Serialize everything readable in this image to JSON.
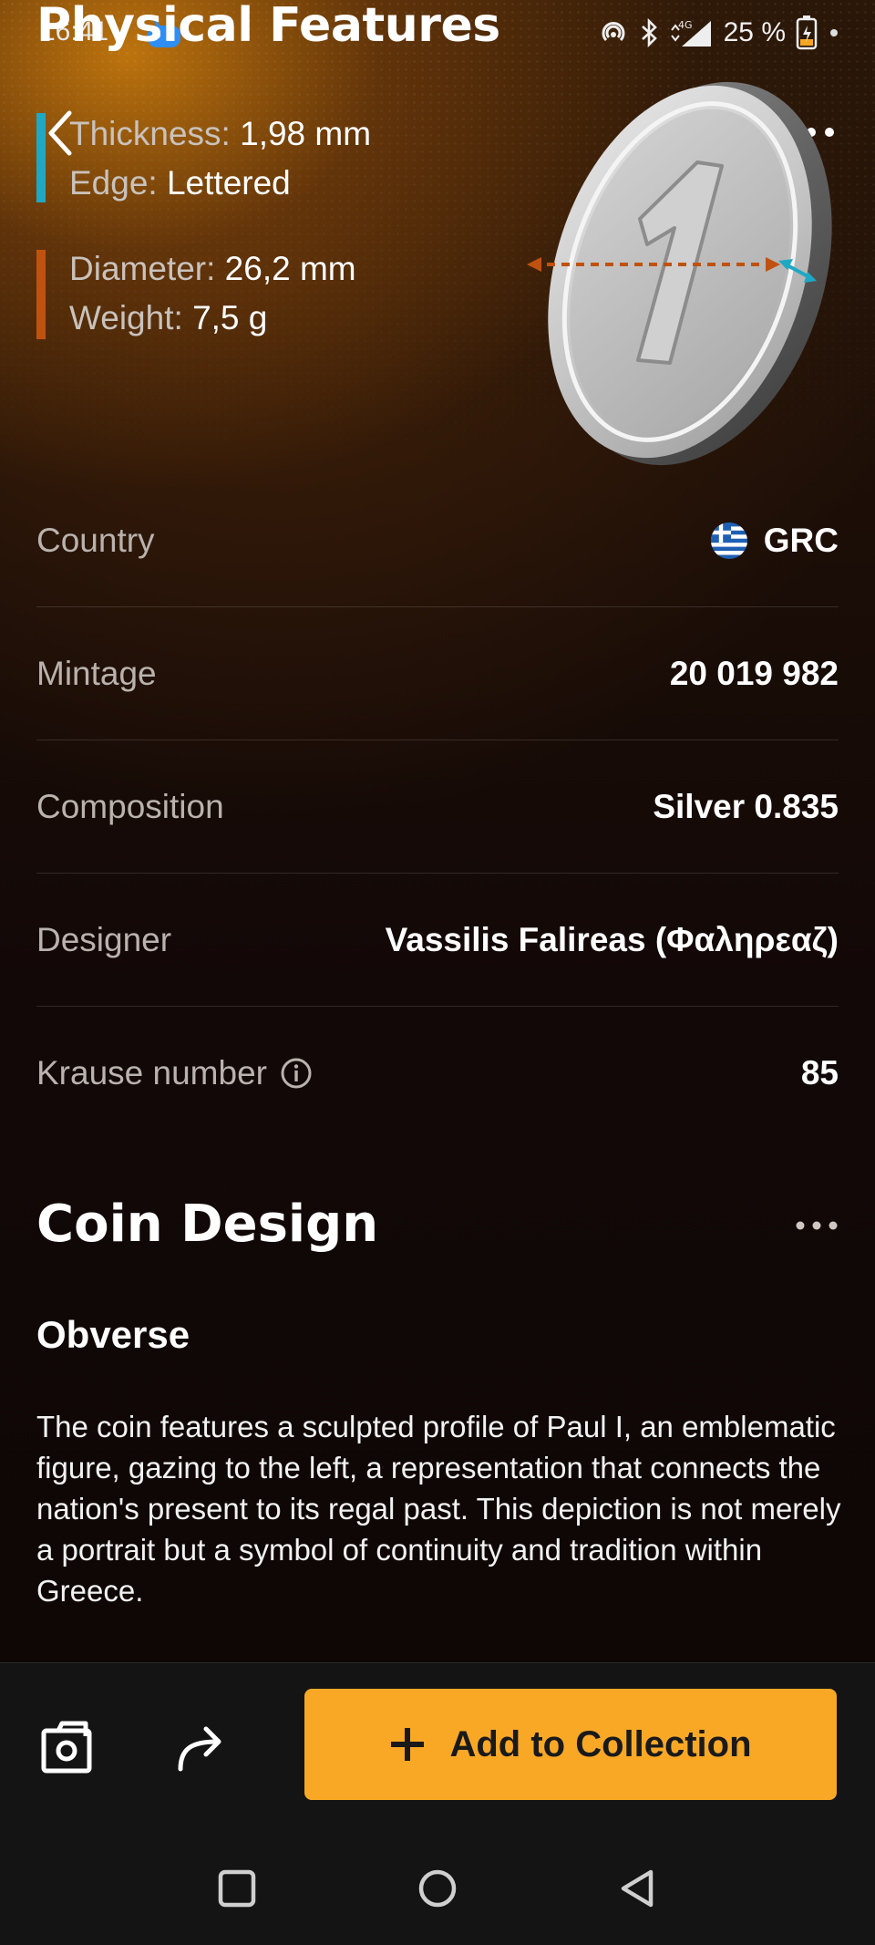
{
  "status_bar": {
    "time": "16:41",
    "battery": "25 %",
    "network": "4G"
  },
  "header": {
    "title": "Physical Features"
  },
  "physical": {
    "thickness_label": "Thickness:",
    "thickness_value": "1,98 mm",
    "edge_label": "Edge:",
    "edge_value": "Lettered",
    "diameter_label": "Diameter:",
    "diameter_value": "26,2 mm",
    "weight_label": "Weight:",
    "weight_value": "7,5 g"
  },
  "colors": {
    "thickness_accent": "#1fa8c4",
    "diameter_accent": "#c0520f",
    "button": "#f9a825"
  },
  "details": {
    "country_label": "Country",
    "country_value": "GRC",
    "mintage_label": "Mintage",
    "mintage_value": "20 019 982",
    "composition_label": "Composition",
    "composition_value": "Silver 0.835",
    "designer_label": "Designer",
    "designer_value": "Vassilis Falireas (Φαληρεαζ)",
    "krause_label": "Krause number",
    "krause_value": "85"
  },
  "design": {
    "section_title": "Coin Design",
    "obverse_title": "Obverse",
    "obverse_text": "The coin features a sculpted profile of Paul I, an emblematic figure, gazing to the left, a representation that connects the nation's present to its regal past. This depiction is not merely a portrait but a symbol of continuity and tradition within Greece."
  },
  "actions": {
    "add_label": "Add to Collection"
  },
  "icons": [
    "back-icon",
    "more-icon",
    "coin-illustration",
    "info-icon",
    "camera-icon",
    "share-icon",
    "plus-icon",
    "nav-recents-icon",
    "nav-home-icon",
    "nav-back-icon"
  ]
}
